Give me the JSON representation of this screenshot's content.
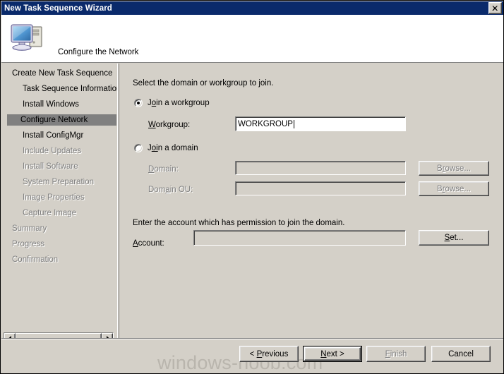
{
  "window": {
    "title": "New Task Sequence Wizard",
    "close_icon": "close-icon"
  },
  "header": {
    "title": "Configure the Network",
    "icon": "computer-icon"
  },
  "sidebar": {
    "items": [
      {
        "label": "Create New Task Sequence",
        "level": "top",
        "state": "enabled"
      },
      {
        "label": "Task Sequence Information",
        "level": "sub",
        "state": "enabled"
      },
      {
        "label": "Install Windows",
        "level": "sub",
        "state": "enabled"
      },
      {
        "label": "Configure Network",
        "level": "sub",
        "state": "current"
      },
      {
        "label": "Install ConfigMgr",
        "level": "sub",
        "state": "enabled"
      },
      {
        "label": "Include Updates",
        "level": "sub",
        "state": "disabled"
      },
      {
        "label": "Install Software",
        "level": "sub",
        "state": "disabled"
      },
      {
        "label": "System Preparation",
        "level": "sub",
        "state": "disabled"
      },
      {
        "label": "Image Properties",
        "level": "sub",
        "state": "disabled"
      },
      {
        "label": "Capture Image",
        "level": "sub",
        "state": "disabled"
      },
      {
        "label": "Summary",
        "level": "top",
        "state": "disabled"
      },
      {
        "label": "Progress",
        "level": "top",
        "state": "disabled"
      },
      {
        "label": "Confirmation",
        "level": "top",
        "state": "disabled"
      }
    ],
    "scrollbar": {
      "left_arrow": "triangle-left-icon",
      "right_arrow": "triangle-right-icon"
    }
  },
  "main": {
    "instruction": "Select the domain or workgroup to join.",
    "workgroup_option": {
      "label_before": "J",
      "label_accel": "o",
      "label_after": "in a workgroup",
      "full_label": "Join a workgroup",
      "selected": true
    },
    "workgroup_field": {
      "label_accel": "W",
      "label_rest": "orkgroup:",
      "full_label": "Workgroup:",
      "value": "WORKGROUP",
      "enabled": true
    },
    "domain_option": {
      "label_before": "J",
      "label_accel": "oi",
      "label_after": "n a domain",
      "full_label": "Join a domain",
      "selected": false
    },
    "domain_field": {
      "label_accel": "D",
      "label_rest": "omain:",
      "full_label": "Domain:",
      "value": "",
      "enabled": false,
      "browse_button": {
        "before": "B",
        "accel": "r",
        "after": "owse...",
        "full_label": "Browse...",
        "enabled": false
      }
    },
    "domain_ou_field": {
      "label_before": "Dom",
      "label_accel": "a",
      "label_after": "in OU:",
      "full_label": "Domain OU:",
      "value": "",
      "enabled": false,
      "browse_button": {
        "before": "B",
        "accel": "r",
        "after": "owse...",
        "full_label": "Browse...",
        "enabled": false
      }
    },
    "account_instruction": "Enter the account which has permission to join the domain.",
    "account_field": {
      "label_accel": "A",
      "label_rest": "ccount:",
      "full_label": "Account:",
      "value": "",
      "enabled": false
    },
    "set_button": {
      "accel": "S",
      "rest": "et...",
      "full_label": "Set...",
      "enabled": true
    }
  },
  "footer": {
    "previous_button": {
      "before": "< ",
      "accel": "P",
      "after": "revious",
      "full_label": "< Previous",
      "enabled": true
    },
    "next_button": {
      "accel": "N",
      "after": "ext >",
      "full_label": "Next >",
      "enabled": true,
      "is_default": true
    },
    "finish_button": {
      "before": "",
      "accel": "F",
      "after": "inish",
      "full_label": "Finish",
      "enabled": false
    },
    "cancel_button": {
      "full_label": "Cancel",
      "enabled": true
    }
  },
  "watermark": {
    "text": "windows-noob.com"
  }
}
